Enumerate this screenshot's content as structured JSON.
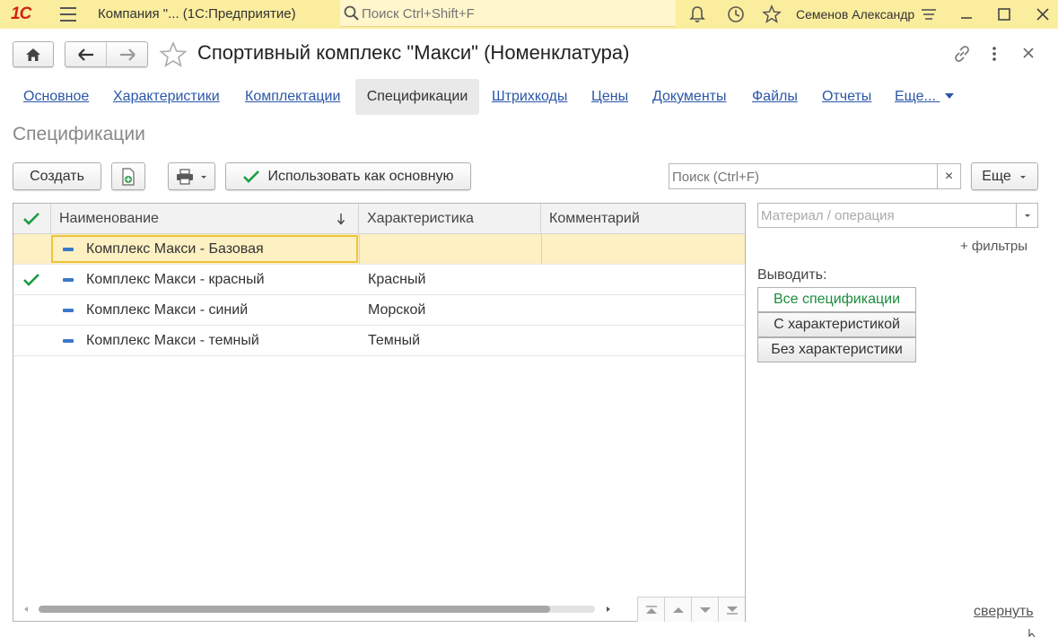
{
  "topbar": {
    "logo": "1С",
    "app_title": "Компания \"...   (1С:Предприятие)",
    "search_placeholder": "Поиск Ctrl+Shift+F",
    "user": "Семенов Александр"
  },
  "window": {
    "title": "Спортивный комплекс \"Макси\" (Номенклатура)"
  },
  "tabs": [
    {
      "label": "Основное"
    },
    {
      "label": "Характеристики"
    },
    {
      "label": "Комплектации"
    },
    {
      "label": "Спецификации",
      "active": true
    },
    {
      "label": "Штрихкоды"
    },
    {
      "label": "Цены"
    },
    {
      "label": "Документы"
    },
    {
      "label": "Файлы"
    },
    {
      "label": "Отчеты"
    },
    {
      "label": "Еще..."
    }
  ],
  "section": {
    "title": "Спецификации"
  },
  "toolbar": {
    "create_label": "Создать",
    "use_main_label": "Использовать как основную",
    "search_placeholder": "Поиск (Ctrl+F)",
    "clear": "×",
    "more_label": "Еще"
  },
  "table": {
    "columns": [
      "Наименование",
      "Характеристика",
      "Комментарий"
    ],
    "rows": [
      {
        "name": "Комплекс Макси - Базовая",
        "characteristic": "",
        "comment": "",
        "main": false,
        "selected": true
      },
      {
        "name": "Комплекс Макси - красный",
        "characteristic": "Красный",
        "comment": "",
        "main": true,
        "selected": false
      },
      {
        "name": "Комплекс Макси - синий",
        "characteristic": "Морской",
        "comment": "",
        "main": false,
        "selected": false
      },
      {
        "name": "Комплекс Макси - темный",
        "characteristic": "Темный",
        "comment": "",
        "main": false,
        "selected": false
      }
    ]
  },
  "right_panel": {
    "material_placeholder": "Материал / операция",
    "filters_link": "+ фильтры",
    "output_label": "Выводить:",
    "options": [
      "Все спецификации",
      "С характеристикой",
      "Без характеристики"
    ],
    "collapse_link": "свернуть"
  },
  "colors": {
    "topbar_bg": "#fbed9e",
    "link": "#2a57a8",
    "check_green": "#1a9c44",
    "selected_row": "#fdf0c3",
    "focus_border": "#f0c23c"
  }
}
